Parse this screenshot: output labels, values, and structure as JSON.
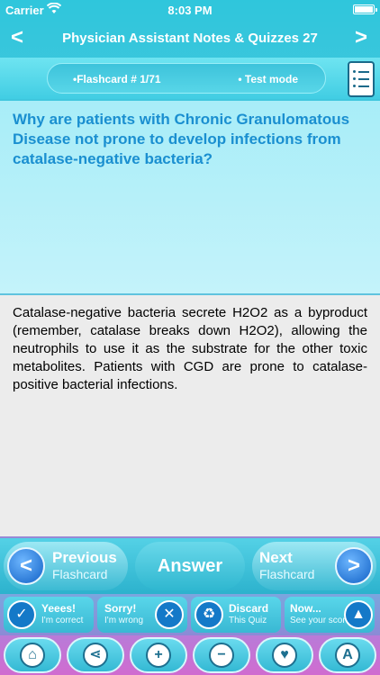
{
  "status": {
    "carrier": "Carrier",
    "time": "8:03 PM"
  },
  "nav": {
    "title": "Physician Assistant Notes & Quizzes 27",
    "back_glyph": "<",
    "forward_glyph": ">"
  },
  "info": {
    "flashcard_label": "•Flashcard #  1/71",
    "mode_label": "• Test mode"
  },
  "card": {
    "question": "Why are patients with Chronic Granulomatous Disease not prone to develop infections from catalase-negative bacteria?",
    "answer": "Catalase-negative bacteria secrete H2O2 as a byproduct (remember, catalase breaks down H2O2), allowing the neutrophils to use it as the substrate for the other toxic metabolites. Patients with CGD are prone to catalase-positive bacterial infections."
  },
  "controls": {
    "previous_big": "Previous",
    "previous_small": "Flashcard",
    "answer": "Answer",
    "next_big": "Next",
    "next_small": "Flashcard"
  },
  "assessment": {
    "yes_big": "Yeees!",
    "yes_small": "I'm correct",
    "sorry_big": "Sorry!",
    "sorry_small": "I'm wrong",
    "discard_big": "Discard",
    "discard_small": "This Quiz",
    "now_big": "Now...",
    "now_small": "See your score"
  },
  "toolbar": {
    "icons": [
      "home-icon",
      "share-icon",
      "zoom-in-icon",
      "zoom-out-icon",
      "bookmark-icon",
      "font-icon"
    ]
  },
  "colors": {
    "question_text": "#1a8fd0",
    "accent_cyan": "#2fc6dc",
    "accent_purple": "#c56fd0"
  }
}
